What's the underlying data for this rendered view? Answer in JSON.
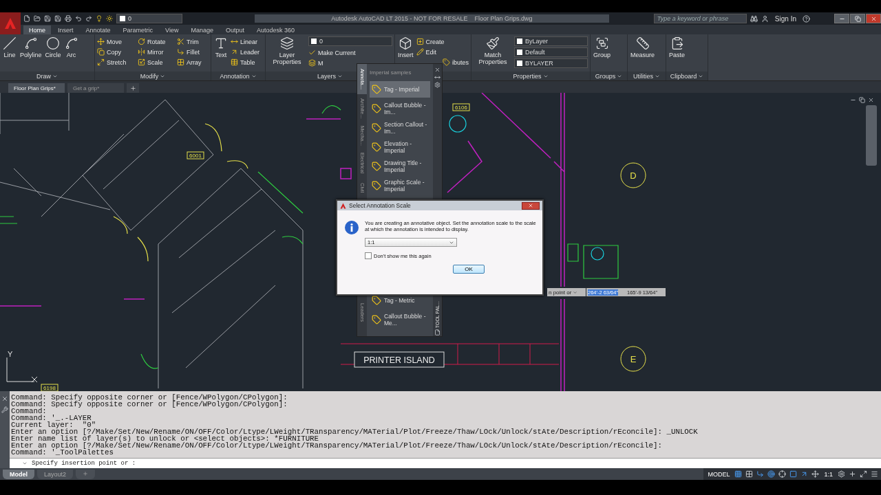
{
  "title_bar": {
    "layer": "0",
    "title": "Autodesk AutoCAD LT 2015 - NOT FOR RESALE    Floor Plan Grips.dwg",
    "search": {
      "placeholder": "Type a keyword or phrase"
    },
    "sign_in": "Sign In"
  },
  "ribbon_tabs": [
    {
      "label": "Home",
      "selected": true
    },
    {
      "label": "Insert",
      "selected": false
    },
    {
      "label": "Annotate",
      "selected": false
    },
    {
      "label": "Parametric",
      "selected": false
    },
    {
      "label": "View",
      "selected": false
    },
    {
      "label": "Manage",
      "selected": false
    },
    {
      "label": "Output",
      "selected": false
    },
    {
      "label": "Autodesk 360",
      "selected": false
    }
  ],
  "ribbon_panels": [
    {
      "title": "Draw",
      "large": [
        "Line",
        "Polyline",
        "Circle",
        "Arc"
      ]
    },
    {
      "title": "Modify",
      "small": [
        "Move",
        "Copy",
        "Stretch",
        "Rotate",
        "Mirror",
        "Scale",
        "Trim",
        "Fillet",
        "Array"
      ]
    },
    {
      "title": "Annotation",
      "large": [
        "Text"
      ],
      "small": [
        "Linear",
        "Leader",
        "Table"
      ]
    },
    {
      "title": "Layers",
      "large": [
        "Layer Properties"
      ],
      "dropdowns": [
        "0"
      ],
      "small": [
        "Make Current",
        "M"
      ]
    },
    {
      "large": [
        "Insert"
      ],
      "small": [
        "Create",
        "Edit",
        "ibutes"
      ]
    },
    {
      "title": "Properties",
      "large": [
        "Match Properties"
      ],
      "dropdowns": [
        "ByLayer",
        "Default",
        "BYLAYER"
      ]
    },
    {
      "title": "Groups",
      "large": [
        "Group"
      ]
    },
    {
      "title": "Utilities",
      "large": [
        "Measure"
      ]
    },
    {
      "title": "Clipboard",
      "large": [
        "Paste"
      ]
    }
  ],
  "file_tabs": [
    {
      "label": "Floor Plan Grips*",
      "selected": true
    },
    {
      "label": "Get a grip*",
      "selected": false
    }
  ],
  "drawing": {
    "room_tags": [
      "6001",
      "6106",
      "6198"
    ],
    "grid_labels": [
      "D",
      "E"
    ],
    "area_label": "PRINTER ISLAND",
    "ucs_label": "Y"
  },
  "tool_palette": {
    "title": "TOOL PAL...",
    "header": "Imperial samples",
    "tabs": [
      {
        "label": "Annota...",
        "selected": true
      },
      {
        "label": "Archite...",
        "selected": false
      },
      {
        "label": "Mecha...",
        "selected": false
      },
      {
        "label": "Electrical",
        "selected": false
      },
      {
        "label": "Civil",
        "selected": false
      }
    ],
    "bottom_tab": "Leaders",
    "items": [
      {
        "label": "Tag - Imperial",
        "selected": true
      },
      {
        "label": "Callout Bubble - Im...",
        "selected": false
      },
      {
        "label": "Section Callout - Im...",
        "selected": false
      },
      {
        "label": "Elevation - Imperial",
        "selected": false
      },
      {
        "label": "Drawing Title - Imperial",
        "selected": false
      },
      {
        "label": "Graphic Scale - Imperial",
        "selected": false
      }
    ],
    "lower_items": [
      {
        "label": "Tag - Metric",
        "selected": false
      },
      {
        "label": "Callout Bubble - Me...",
        "selected": false
      }
    ]
  },
  "dialog": {
    "title": "Select Annotation Scale",
    "message": "You are creating an annotative object.  Set the annotation scale to the scale at which the annotation is intended to display.",
    "scale": "1:1",
    "checkbox": {
      "label": "Don't show me this again",
      "checked": false
    },
    "button": "OK"
  },
  "dynamic_input": {
    "prompt": "n point or",
    "x_value": "264'-2 63/64\"",
    "y_value": "165'-9 13/64\""
  },
  "command_line": {
    "history": [
      "Command: Specify opposite corner or [Fence/WPolygon/CPolygon]:",
      "Command: Specify opposite corner or [Fence/WPolygon/CPolygon]:",
      "Command:",
      "Command: '_.-LAYER",
      "Current layer:  \"0\"",
      "Enter an option [?/Make/Set/New/Rename/ON/OFF/Color/Ltype/LWeight/TRansparency/MATerial/Plot/Freeze/Thaw/LOck/Unlock/stAte/Description/rEconcile]: _UNLOCK",
      "Enter name list of layer(s) to unlock or <select objects>: *FURNITURE",
      "Enter an option [?/Make/Set/New/Rename/ON/OFF/Color/Ltype/LWeight/TRansparency/MATerial/Plot/Freeze/Thaw/LOck/Unlock/stAte/Description/rEconcile]:",
      "Command: '_ToolPalettes"
    ],
    "prompt": "Specify insertion point or :"
  },
  "layout_tabs": [
    {
      "label": "Model",
      "selected": true
    },
    {
      "label": "Layout2",
      "selected": false
    }
  ],
  "status_bar": {
    "space": "MODEL",
    "scale": "1:1"
  }
}
